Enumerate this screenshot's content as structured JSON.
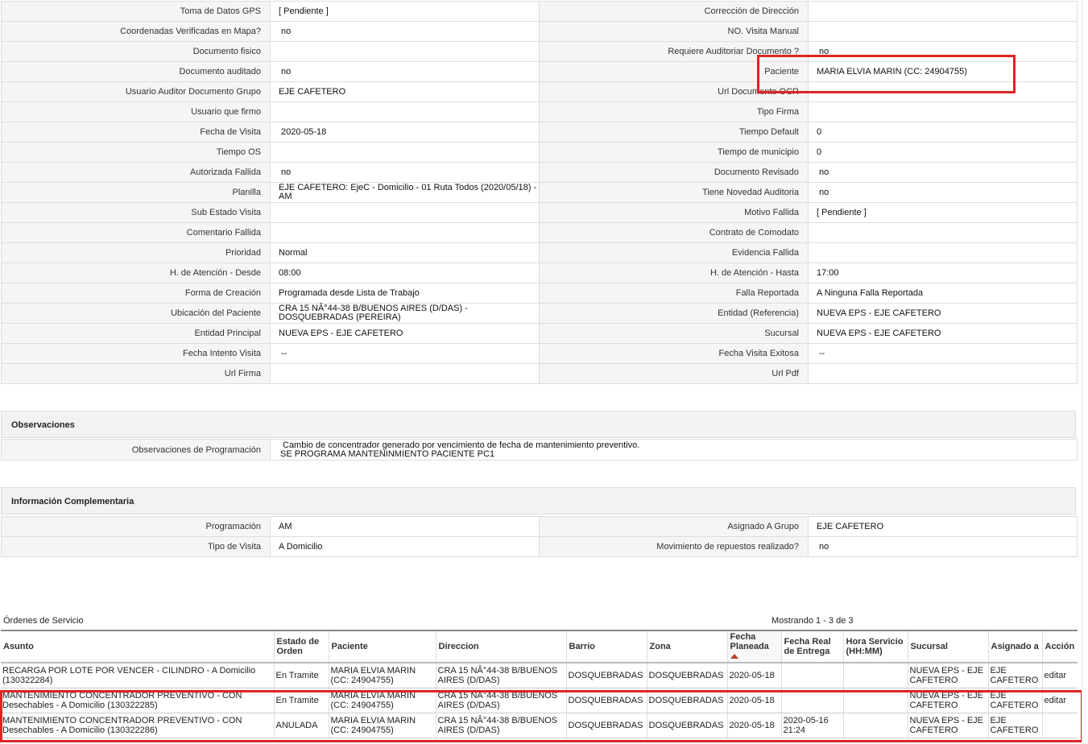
{
  "details": {
    "rows": [
      {
        "l1": "Toma de Datos GPS",
        "v1": "[ Pendiente ]",
        "l2": "Corrección de Dirección",
        "v2": ""
      },
      {
        "l1": "Coordenadas Verificadas en Mapa?",
        "v1": "no",
        "l2": "NO. Visita Manual",
        "v2": ""
      },
      {
        "l1": "Documento fisico",
        "v1": "",
        "l2": "Requiere Auditoriar Documento ?",
        "v2": "no"
      },
      {
        "l1": "Documento auditado",
        "v1": "no",
        "l2": "Paciente",
        "v2": "MARIA ELVIA MARIN (CC: 24904755)"
      },
      {
        "l1": "Usuario Auditor Documento Grupo",
        "v1": "EJE CAFETERO",
        "l2": "Url Documento OCR",
        "v2": ""
      },
      {
        "l1": "Usuario que firmo",
        "v1": "",
        "l2": "Tipo Firma",
        "v2": ""
      },
      {
        "l1": "Fecha de Visita",
        "v1": "2020-05-18",
        "l2": "Tiempo Default",
        "v2": "0"
      },
      {
        "l1": "Tiempo OS",
        "v1": "",
        "l2": "Tiempo de municipio",
        "v2": "0"
      },
      {
        "l1": "Autorizada Fallida",
        "v1": "no",
        "l2": "Documento Revisado",
        "v2": "no"
      },
      {
        "l1": "Planilla",
        "v1": "EJE CAFETERO: EjeC - Domicilio - 01 Ruta Todos (2020/05/18) - AM",
        "l2": "Tiene Novedad Auditoria",
        "v2": "no"
      },
      {
        "l1": "Sub Estado Visita",
        "v1": "",
        "l2": "Motivo Fallida",
        "v2": "[ Pendiente ]"
      },
      {
        "l1": "Comentario Fallida",
        "v1": "",
        "l2": "Contrato de Comodato",
        "v2": ""
      },
      {
        "l1": "Prioridad",
        "v1": "Normal",
        "l2": "Evidencia Fallida",
        "v2": ""
      },
      {
        "l1": "H. de Atención - Desde",
        "v1": "08:00",
        "l2": "H. de Atención - Hasta",
        "v2": "17:00"
      },
      {
        "l1": "Forma de Creación",
        "v1": "Programada desde Lista de Trabajo",
        "l2": "Falla Reportada",
        "v2": "A Ninguna Falla Reportada"
      },
      {
        "l1": "Ubicación del Paciente",
        "v1": "CRA 15 NÂ°44-38 B/BUENOS AIRES (D/DAS) - DOSQUEBRADAS (PEREIRA)",
        "l2": "Entidad (Referencia)",
        "v2": "NUEVA EPS - EJE CAFETERO"
      },
      {
        "l1": "Entidad Principal",
        "v1": "NUEVA EPS - EJE CAFETERO",
        "l2": "Sucursal",
        "v2": "NUEVA EPS - EJE CAFETERO"
      },
      {
        "l1": "Fecha Intento Visita",
        "v1": "--",
        "l2": "Fecha Visita Exitosa",
        "v2": "--"
      },
      {
        "l1": "Url Firma",
        "v1": "",
        "l2": "Url Pdf",
        "v2": ""
      }
    ]
  },
  "observaciones": {
    "title": "Observaciones",
    "label": "Observaciones de Programación",
    "line1": "Cambio de concentrador generado por vencimiento de fecha de mantenimiento preventivo.",
    "line2": "SE PROGRAMA MANTENINMIENTO PACIENTE PC1"
  },
  "complementaria": {
    "title": "Información Complementaria",
    "rows": [
      {
        "l1": "Programación",
        "v1": "AM",
        "l2": "Asignado A Grupo",
        "v2": "EJE CAFETERO"
      },
      {
        "l1": "Tipo de Visita",
        "v1": "A Domicilio",
        "l2": "Movimiento de repuestos realizado?",
        "v2": "no"
      }
    ]
  },
  "orders": {
    "title": "Órdenes de Servicio",
    "count_text": "Mostrando 1 - 3 de 3",
    "headers": {
      "asunto": "Asunto",
      "estado": "Estado de Orden",
      "paciente": "Paciente",
      "direccion": "Direccion",
      "barrio": "Barrio",
      "zona": "Zona",
      "fecha_planeada": "Fecha Planeada",
      "fecha_real": "Fecha Real de Entrega",
      "hora": "Hora Servicio (HH:MM)",
      "sucursal": "Sucursal",
      "asignado": "Asignado a",
      "accion": "Acción"
    },
    "rows": [
      {
        "asunto": "RECARGA POR LOTE POR VENCER - CILINDRO - A Domicilio (130322284)",
        "estado": "En Tramite",
        "paciente": "MARIA ELVIA MARIN (CC: 24904755)",
        "direccion": "CRA 15 NÂ°44-38 B/BUENOS AIRES (D/DAS)",
        "barrio": "DOSQUEBRADAS",
        "zona": "DOSQUEBRADAS",
        "fecha_planeada": "2020-05-18",
        "fecha_real": "",
        "hora": "",
        "sucursal": "NUEVA EPS - EJE CAFETERO",
        "asignado": "EJE CAFETERO",
        "accion": "editar"
      },
      {
        "asunto": "MANTENIMIENTO CONCENTRADOR PREVENTIVO - CON Desechables - A Domicilio (130322285)",
        "estado": "En Tramite",
        "paciente": "MARIA ELVIA MARIN (CC: 24904755)",
        "direccion": "CRA 15 NÂ°44-38 B/BUENOS AIRES (D/DAS)",
        "barrio": "DOSQUEBRADAS",
        "zona": "DOSQUEBRADAS",
        "fecha_planeada": "2020-05-18",
        "fecha_real": "",
        "hora": "",
        "sucursal": "NUEVA EPS - EJE CAFETERO",
        "asignado": "EJE CAFETERO",
        "accion": "editar"
      },
      {
        "asunto": "MANTENIMIENTO CONCENTRADOR PREVENTIVO - CON Desechables - A Domicilio (130322286)",
        "estado": "ANULADA",
        "paciente": "MARIA ELVIA MARIN (CC: 24904755)",
        "direccion": "CRA 15 NÂ°44-38 B/BUENOS AIRES (D/DAS)",
        "barrio": "DOSQUEBRADAS",
        "zona": "DOSQUEBRADAS",
        "fecha_planeada": "2020-05-18",
        "fecha_real": "2020-05-16 21:24",
        "hora": "",
        "sucursal": "NUEVA EPS - EJE CAFETERO",
        "asignado": "EJE CAFETERO",
        "accion": ""
      }
    ]
  },
  "colors": {
    "highlight": "#e02424",
    "label_bg": "#f5f5f5",
    "border": "#dddddd"
  }
}
